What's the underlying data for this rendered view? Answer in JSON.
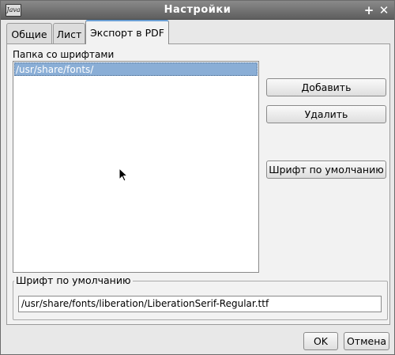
{
  "window": {
    "title": "Настройки",
    "app_icon_text": "Java",
    "pin_glyph": "+",
    "close_glyph": "✕"
  },
  "tabs": [
    {
      "label": "Общие",
      "active": false
    },
    {
      "label": "Лист",
      "active": false
    },
    {
      "label": "Экспорт в PDF",
      "active": true
    }
  ],
  "fonts_panel": {
    "label": "Папка со шрифтами",
    "folders": [
      "/usr/share/fonts/"
    ],
    "selected_index": 0,
    "add_label": "Добавить",
    "remove_label": "Удалить",
    "default_font_label": "Шрифт по умолчанию"
  },
  "default_font": {
    "group_title": "Шрифт по умолчанию",
    "path": "/usr/share/fonts/liberation/LiberationSerif-Regular.ttf"
  },
  "footer": {
    "ok_label": "OK",
    "cancel_label": "Отмена"
  },
  "colors": {
    "titlebar": "#6f6f6f",
    "selection": "#8aaed6",
    "active_tab_accent": "#6a9fd5"
  }
}
